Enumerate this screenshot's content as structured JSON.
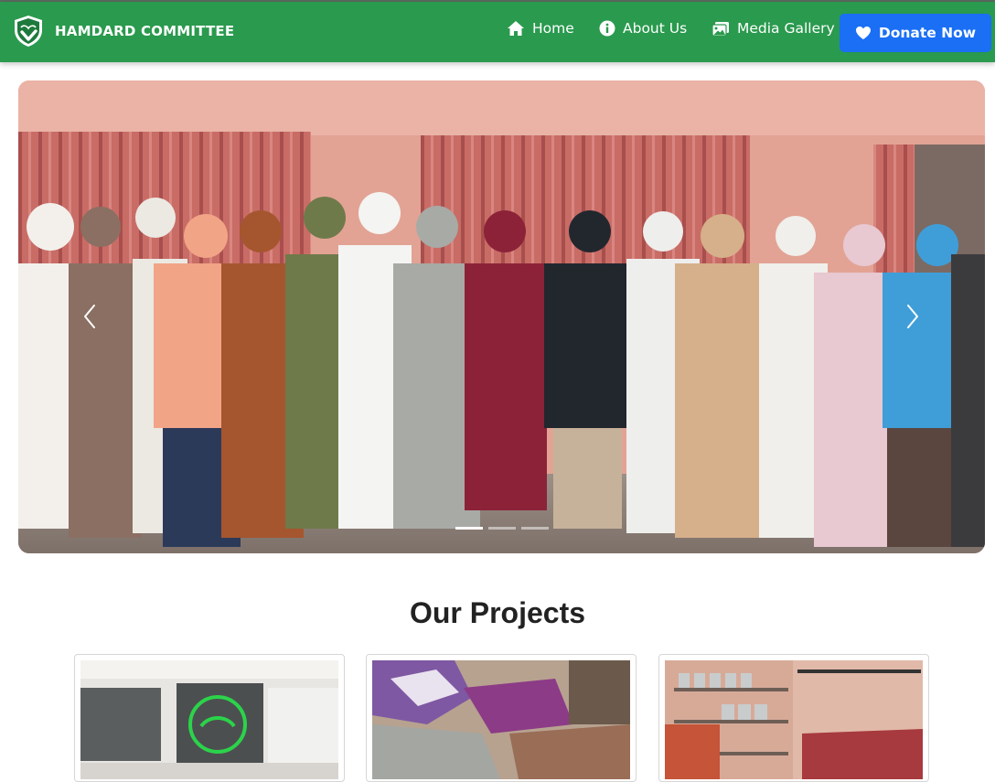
{
  "brand": {
    "name": "HAMDARD COMMITTEE",
    "logo_icon": "shield-heart-icon",
    "colors": {
      "navbar": "#2a9a4e",
      "donate": "#1a6ff5"
    }
  },
  "nav": {
    "items": [
      {
        "label": "Home",
        "icon": "home-icon"
      },
      {
        "label": "About Us",
        "icon": "info-circle-icon"
      },
      {
        "label": "Media Gallery",
        "icon": "images-icon"
      }
    ],
    "donate": {
      "label": "Donate Now",
      "icon": "heart-icon"
    }
  },
  "carousel": {
    "slide_count": 3,
    "active_slide": 1
  },
  "projects": {
    "title": "Our Projects",
    "count": 3
  }
}
